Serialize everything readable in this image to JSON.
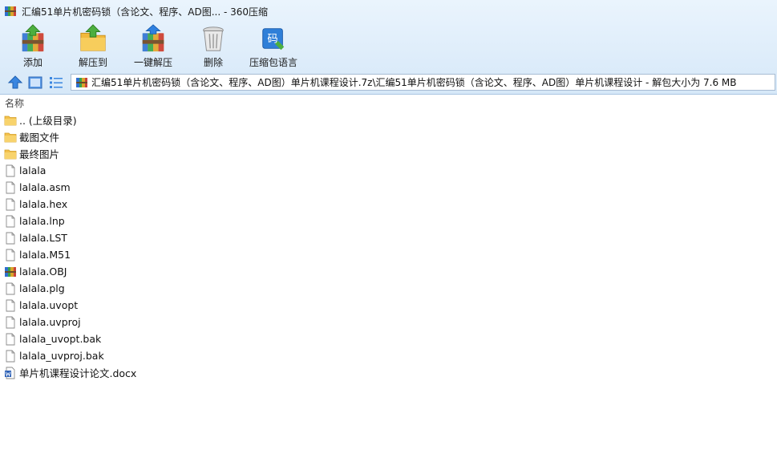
{
  "window": {
    "title": "汇编51单片机密码锁（含论文、程序、AD图... - 360压缩"
  },
  "toolbar": {
    "add_label": "添加",
    "extract_to_label": "解压到",
    "one_click_extract_label": "一键解压",
    "delete_label": "删除",
    "encoding_label": "压缩包语言",
    "encoding_icon_text": "码"
  },
  "path": {
    "text": "汇编51单片机密码锁（含论文、程序、AD图）单片机课程设计.7z\\汇编51单片机密码锁（含论文、程序、AD图）单片机课程设计 - 解包大小为 7.6 MB"
  },
  "columns": {
    "name": "名称"
  },
  "files": [
    {
      "name": ".. (上级目录)",
      "icon": "folder-icon"
    },
    {
      "name": "截图文件",
      "icon": "folder-icon"
    },
    {
      "name": "最终图片",
      "icon": "folder-icon"
    },
    {
      "name": "lalala",
      "icon": "file-icon"
    },
    {
      "name": "lalala.asm",
      "icon": "file-icon"
    },
    {
      "name": "lalala.hex",
      "icon": "file-icon"
    },
    {
      "name": "lalala.lnp",
      "icon": "file-icon"
    },
    {
      "name": "lalala.LST",
      "icon": "file-icon"
    },
    {
      "name": "lalala.M51",
      "icon": "file-icon"
    },
    {
      "name": "lalala.OBJ",
      "icon": "archive-icon"
    },
    {
      "name": "lalala.plg",
      "icon": "file-icon"
    },
    {
      "name": "lalala.uvopt",
      "icon": "file-icon"
    },
    {
      "name": "lalala.uvproj",
      "icon": "file-icon"
    },
    {
      "name": "lalala_uvopt.bak",
      "icon": "file-icon"
    },
    {
      "name": "lalala_uvproj.bak",
      "icon": "file-icon"
    },
    {
      "name": "单片机课程设计论文.docx",
      "icon": "word-doc-icon"
    }
  ]
}
